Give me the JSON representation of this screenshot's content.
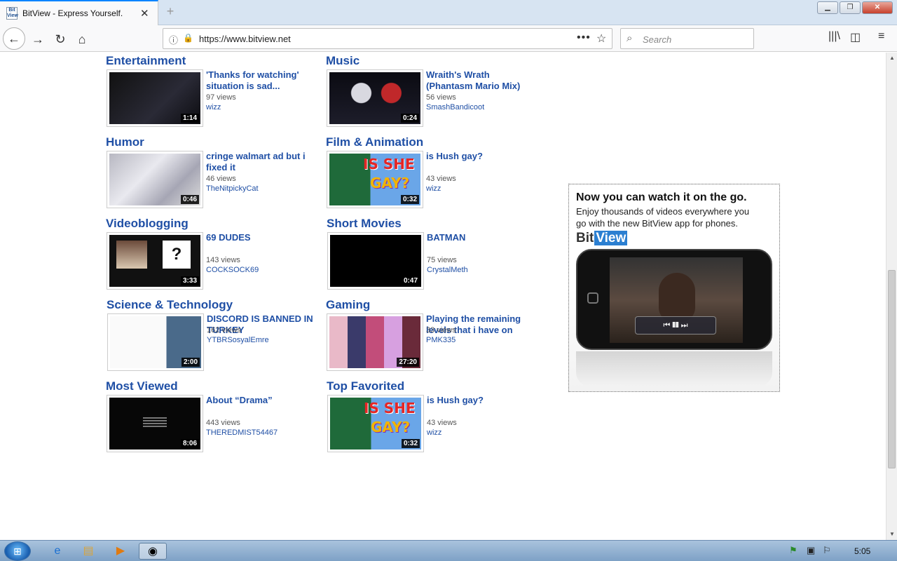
{
  "browser": {
    "tab_title": "BitView - Express Yourself.",
    "favicon_text": "Bit View",
    "url": "https://www.bitview.net",
    "search_placeholder": "Search"
  },
  "sections": [
    {
      "title": "Entertainment",
      "video_title": "'Thanks for watching' situation is sad...",
      "views": "97 views",
      "author": "wizz",
      "duration": "1:14"
    },
    {
      "title": "Music",
      "video_title": "Wraith's Wrath (Phantasm Mario Mix)",
      "views": "56 views",
      "author": "SmashBandicoot",
      "duration": "0:24"
    },
    {
      "title": "Humor",
      "video_title": "cringe walmart ad but i fixed it",
      "views": "46 views",
      "author": "TheNitpickyCat",
      "duration": "0:46"
    },
    {
      "title": "Film & Animation",
      "video_title": "is Hush gay?",
      "views": "43 views",
      "author": "wizz",
      "duration": "0:32"
    },
    {
      "title": "Videoblogging",
      "video_title": "69 DUDES",
      "views": "143 views",
      "author": "COCKSOCK69",
      "duration": "3:33"
    },
    {
      "title": "Short Movies",
      "video_title": "BATMAN",
      "views": "75 views",
      "author": "CrystalMeth",
      "duration": "0:47"
    },
    {
      "title": "Science & Technology",
      "video_title": "DISCORD IS BANNED IN TURKEY",
      "views": "162 views",
      "author": "YTBRSosyalEmre",
      "duration": "2:00"
    },
    {
      "title": "Gaming",
      "video_title": "Playing the remaining levels that i have on",
      "views": "33 views",
      "author": "PMK335",
      "duration": "27:20"
    },
    {
      "title": "Most Viewed",
      "video_title": "About “Drama”",
      "views": "443 views",
      "author": "THEREDMIST54467",
      "duration": "8:06"
    },
    {
      "title": "Top Favorited",
      "video_title": "is Hush gay?",
      "views": "43 views",
      "author": "wizz",
      "duration": "0:32"
    }
  ],
  "thumb_text": {
    "hush_line1": "IS SHE",
    "hush_line2": "GAY?",
    "dudes_mark": "?"
  },
  "ad": {
    "headline": "Now you can watch it on the go.",
    "body": "Enjoy thousands of videos everywhere you go with the new BitView app for phones.",
    "logo_bit": "Bit",
    "logo_view": "View"
  },
  "taskbar": {
    "clock": "5:05"
  }
}
